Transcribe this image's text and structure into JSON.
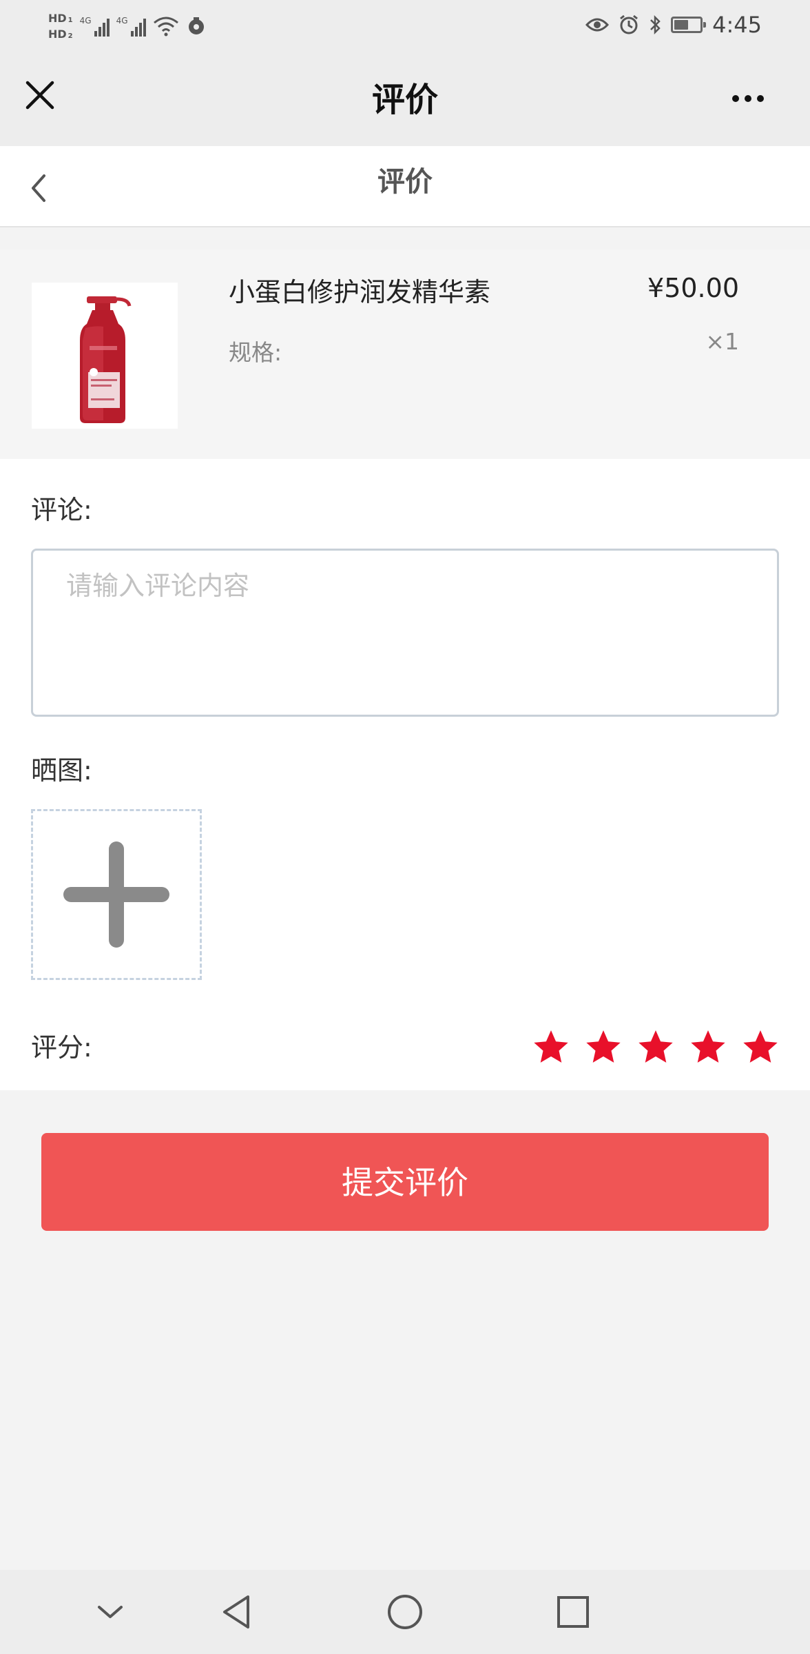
{
  "status_bar": {
    "hd1": "HD",
    "hd1_sub": "1",
    "hd2": "HD",
    "hd2_sub": "2",
    "signal1_label": "4G",
    "signal2_label": "4G",
    "battery_level": 0.55,
    "time": "4:45",
    "icons": [
      "wifi-icon",
      "notification-icon",
      "eye-icon",
      "alarm-icon",
      "bluetooth-icon",
      "battery-icon"
    ]
  },
  "titlebar": {
    "title": "评价",
    "close_icon": "close-icon",
    "more_icon": "more-icon"
  },
  "page_header": {
    "title": "评价",
    "back_icon": "chevron-left-icon"
  },
  "product": {
    "name": "小蛋白修护润发精华素",
    "spec_label": "规格:",
    "price": "¥50.00",
    "quantity": "×1",
    "image": "product-bottle-image"
  },
  "form": {
    "comment_label": "评论:",
    "comment_placeholder": "请输入评论内容",
    "comment_value": "",
    "photo_label": "晒图:",
    "upload_icon": "plus-icon",
    "rating_label": "评分:",
    "rating": 5,
    "rating_max": 5,
    "star_color": "#e8102a"
  },
  "submit": {
    "label": "提交评价",
    "color": "#f05555"
  },
  "nav_bar": {
    "icons": [
      "chevron-down-icon",
      "back-triangle-icon",
      "home-circle-icon",
      "recent-square-icon"
    ]
  }
}
